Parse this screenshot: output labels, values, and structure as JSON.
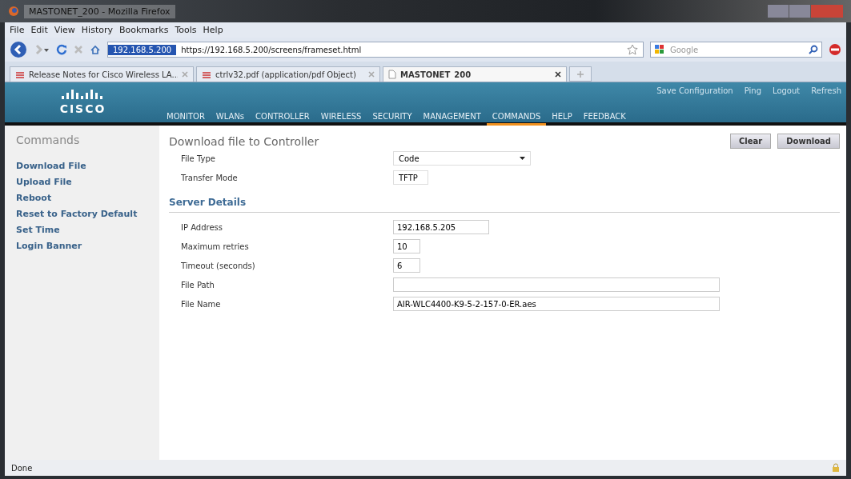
{
  "window": {
    "title": "MASTONET_200 - Mozilla Firefox"
  },
  "menu": [
    "File",
    "Edit",
    "View",
    "History",
    "Bookmarks",
    "Tools",
    "Help"
  ],
  "address_bar": {
    "site": "192.168.5.200",
    "url": "https://192.168.5.200/screens/frameset.html"
  },
  "search": {
    "placeholder": "Google"
  },
  "tabs": [
    {
      "label": "Release Notes for Cisco Wireless LA...",
      "selected": false,
      "kind": "pdf"
    },
    {
      "label": "ctrlv32.pdf (application/pdf Object)",
      "selected": false,
      "kind": "pdf"
    },
    {
      "label": "MASTONET_200",
      "selected": true,
      "kind": "page"
    }
  ],
  "header": {
    "logo": "CISCO",
    "links": [
      "Save Configuration",
      "Ping",
      "Logout",
      "Refresh"
    ],
    "nav": [
      {
        "label": "MONITOR",
        "selected": false
      },
      {
        "label": "WLANs",
        "selected": false
      },
      {
        "label": "CONTROLLER",
        "selected": false
      },
      {
        "label": "WIRELESS",
        "selected": false
      },
      {
        "label": "SECURITY",
        "selected": false
      },
      {
        "label": "MANAGEMENT",
        "selected": false
      },
      {
        "label": "COMMANDS",
        "selected": true
      },
      {
        "label": "HELP",
        "selected": false
      },
      {
        "label": "FEEDBACK",
        "selected": false
      }
    ]
  },
  "sidebar": {
    "title": "Commands",
    "items": [
      "Download File",
      "Upload File",
      "Reboot",
      "Reset to Factory Default",
      "Set Time",
      "Login Banner"
    ]
  },
  "page": {
    "title": "Download file to Controller",
    "buttons": [
      "Clear",
      "Download"
    ],
    "fields": [
      {
        "label": "File Type",
        "kind": "select",
        "value": "Code"
      },
      {
        "label": "Transfer Mode",
        "kind": "select",
        "value": "TFTP"
      }
    ],
    "section": "Server Details",
    "server_fields": [
      {
        "label": "IP Address",
        "kind": "input",
        "value": "192.168.5.205"
      },
      {
        "label": "Maximum retries",
        "kind": "input",
        "value": "10"
      },
      {
        "label": "Timeout (seconds)",
        "kind": "input",
        "value": "6"
      },
      {
        "label": "File Path",
        "kind": "input"
      },
      {
        "label": "File Name",
        "kind": "input",
        "value": "AIR-WLC4400-K9-5-2-157-0-ER.aes"
      }
    ]
  },
  "status_bar": {
    "text": "Done"
  }
}
